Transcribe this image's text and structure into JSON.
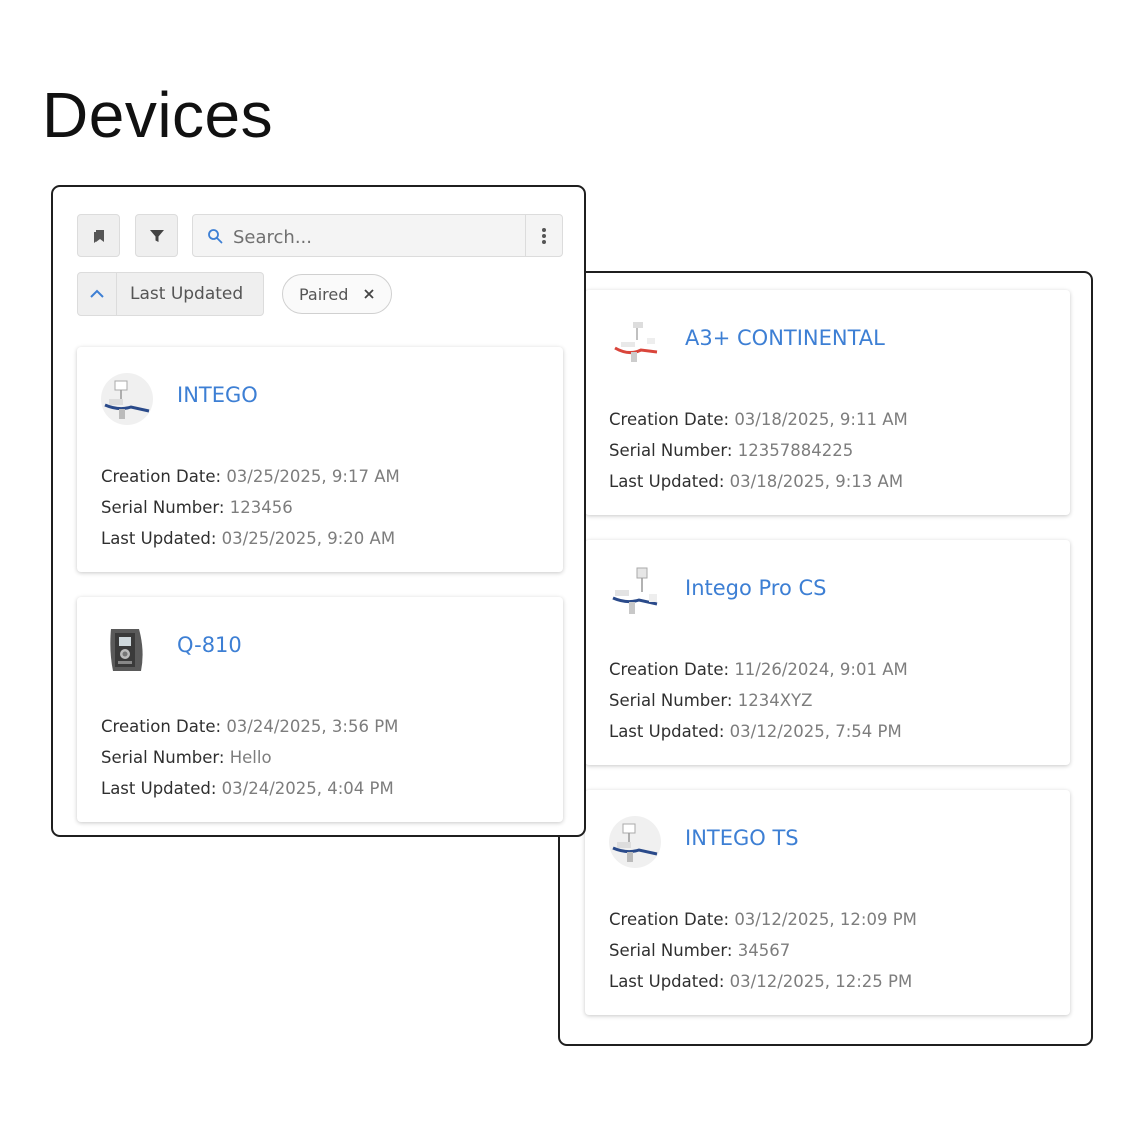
{
  "page_title": "Devices",
  "search": {
    "placeholder": "Search..."
  },
  "sort": {
    "label": "Last Updated"
  },
  "filter_chip": {
    "label": "Paired"
  },
  "field_labels": {
    "creation": "Creation Date:",
    "serial": "Serial Number:",
    "updated": "Last Updated:"
  },
  "colors": {
    "link": "#3d7fd4",
    "panel_border": "#1f1f1f"
  },
  "devices": [
    {
      "name": "INTEGO",
      "creation_date": "03/25/2025, 9:17 AM",
      "serial_number": "123456",
      "last_updated": "03/25/2025, 9:20 AM"
    },
    {
      "name": "Q-810",
      "creation_date": "03/24/2025, 3:56 PM",
      "serial_number": "Hello",
      "last_updated": "03/24/2025, 4:04 PM"
    },
    {
      "name": "A3+ CONTINENTAL",
      "creation_date": "03/18/2025, 9:11 AM",
      "serial_number": "12357884225",
      "last_updated": "03/18/2025, 9:13 AM"
    },
    {
      "name": "Intego Pro CS",
      "creation_date": "11/26/2024, 9:01 AM",
      "serial_number": "1234XYZ",
      "last_updated": "03/12/2025, 7:54 PM"
    },
    {
      "name": "INTEGO TS",
      "creation_date": "03/12/2025, 12:09 PM",
      "serial_number": "34567",
      "last_updated": "03/12/2025, 12:25 PM"
    }
  ]
}
